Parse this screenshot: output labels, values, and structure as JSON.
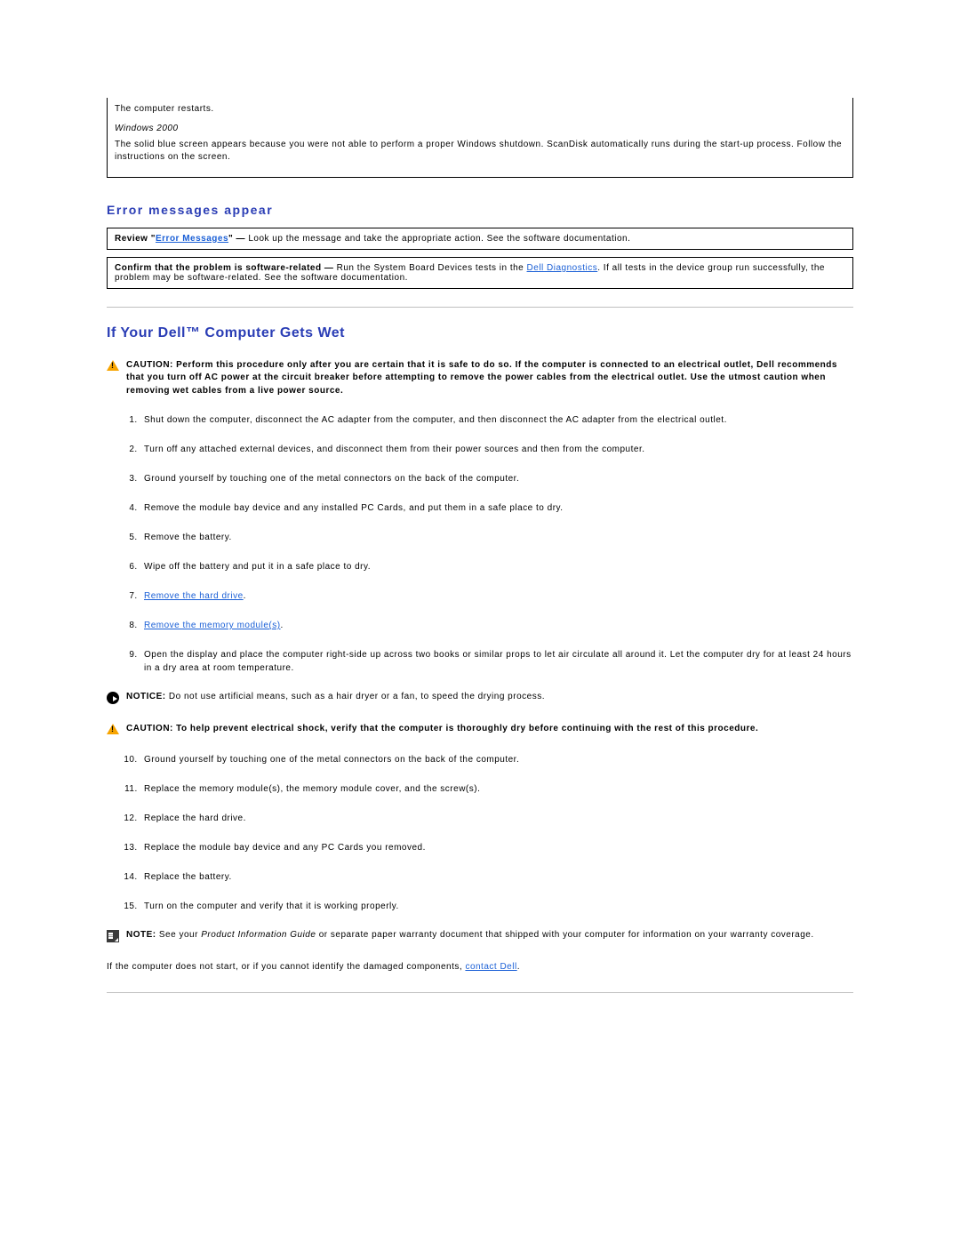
{
  "top_box": {
    "line1": "The computer restarts.",
    "os_label": "Windows 2000",
    "line2": "The solid blue screen appears because you were not able to perform a proper Windows shutdown. ScanDisk automatically runs during the start-up process. Follow the instructions on the screen."
  },
  "error_section": {
    "heading": "Error messages appear",
    "box1": {
      "prefix": "Review \"",
      "link_text": "Error Messages",
      "suffix_bold": "\" —",
      "suffix_rest": " Look up the message and take the appropriate action. See the software documentation."
    },
    "box2": {
      "bold": "Confirm that the problem is software-related —",
      "rest_before": " Run the System Board Devices tests in the ",
      "link_text": "Dell Diagnostics",
      "rest_after": ". If all tests in the device group run successfully, the problem may be software-related. See the software documentation."
    }
  },
  "wet_section": {
    "heading": "If Your Dell™ Computer Gets Wet",
    "caution1": {
      "label": "CAUTION:",
      "text": " Perform this procedure only after you are certain that it is safe to do so. If the computer is connected to an electrical outlet, Dell recommends that you turn off AC power at the circuit breaker before attempting to remove the power cables from the electrical outlet. Use the utmost caution when removing wet cables from a live power source."
    },
    "steps_a": [
      "Shut down the computer, disconnect the AC adapter from the computer, and then disconnect the AC adapter from the electrical outlet.",
      "Turn off any attached external devices, and disconnect them from their power sources and then from the computer.",
      "Ground yourself by touching one of the metal connectors on the back of the computer.",
      "Remove the module bay device and any installed PC Cards, and put them in a safe place to dry.",
      "Remove the battery.",
      "Wipe off the battery and put it in a safe place to dry."
    ],
    "step7_link": "Remove the hard drive",
    "step8_link": "Remove the memory module(s)",
    "step9": "Open the display and place the computer right-side up across two books or similar props to let air circulate all around it. Let the computer dry for at least 24 hours in a dry area at room temperature.",
    "notice": {
      "label": "NOTICE:",
      "text": " Do not use artificial means, such as a hair dryer or a fan, to speed the drying process."
    },
    "caution2": {
      "label": "CAUTION:",
      "text": " To help prevent electrical shock, verify that the computer is thoroughly dry before continuing with the rest of this procedure."
    },
    "steps_b": [
      "Ground yourself by touching one of the metal connectors on the back of the computer.",
      "Replace the memory module(s), the memory module cover, and the screw(s).",
      "Replace the hard drive.",
      "Replace the module bay device and any PC Cards you removed.",
      "Replace the battery.",
      "Turn on the computer and verify that it is working properly."
    ],
    "note": {
      "label": "NOTE:",
      "text_before": " See your ",
      "italic": "Product Information Guide",
      "text_after": " or separate paper warranty document that shipped with your computer for information on your warranty coverage."
    },
    "footer": {
      "before": "If the computer does not start, or if you cannot identify the damaged components, ",
      "link": "contact Dell",
      "after": "."
    }
  }
}
